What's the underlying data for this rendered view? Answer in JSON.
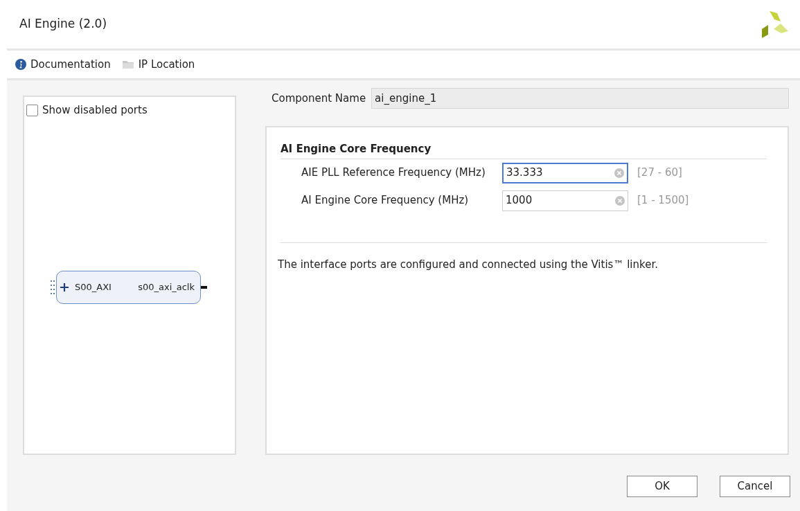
{
  "window": {
    "title": "AI Engine (2.0)"
  },
  "toolbar": [
    {
      "kind": "info",
      "label": "Documentation"
    },
    {
      "kind": "folder",
      "label": "IP Location"
    }
  ],
  "left_panel": {
    "show_disabled_ports": {
      "label": "Show disabled ports",
      "checked": false
    },
    "block": {
      "input_port": "S00_AXI",
      "output_port": "s00_axi_aclk"
    }
  },
  "component_name": {
    "label": "Component Name",
    "value": "ai_engine_1"
  },
  "section": {
    "title": "AI Engine Core Frequency",
    "fields": [
      {
        "label": "AIE PLL Reference Frequency (MHz)",
        "value": "33.333",
        "range": "[27 - 60]",
        "focused": true
      },
      {
        "label": "AI Engine Core Frequency (MHz)",
        "value": "1000",
        "range": "[1 - 1500]",
        "focused": false
      }
    ]
  },
  "note": "The interface ports are configured and connected using the Vitis™ linker.",
  "buttons": [
    "OK",
    "Cancel"
  ]
}
